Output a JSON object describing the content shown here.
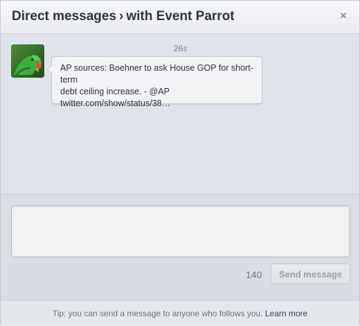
{
  "dialog": {
    "title_main": "Direct messages",
    "title_separator": "›",
    "title_sub": "with Event Parrot",
    "close_glyph": "×"
  },
  "thread": {
    "messages": [
      {
        "timestamp": "26s",
        "text_line1": "AP sources: Boehner to ask House GOP for short-term",
        "text_line2": "debt ceiling increase. - ",
        "mention": "@AP",
        "link": "twitter.com/show/status/38…",
        "avatar_icon": "parrot-avatar-icon"
      }
    ]
  },
  "composer": {
    "input_value": "",
    "char_count": "140",
    "send_label": "Send message"
  },
  "footer": {
    "tip_text": "Tip: you can send a message to anyone who follows you. ",
    "learn_more": "Learn more"
  },
  "colors": {
    "title": "#2c3440",
    "send_disabled_text": "#9aa0a7",
    "link": "#2f3f62"
  }
}
